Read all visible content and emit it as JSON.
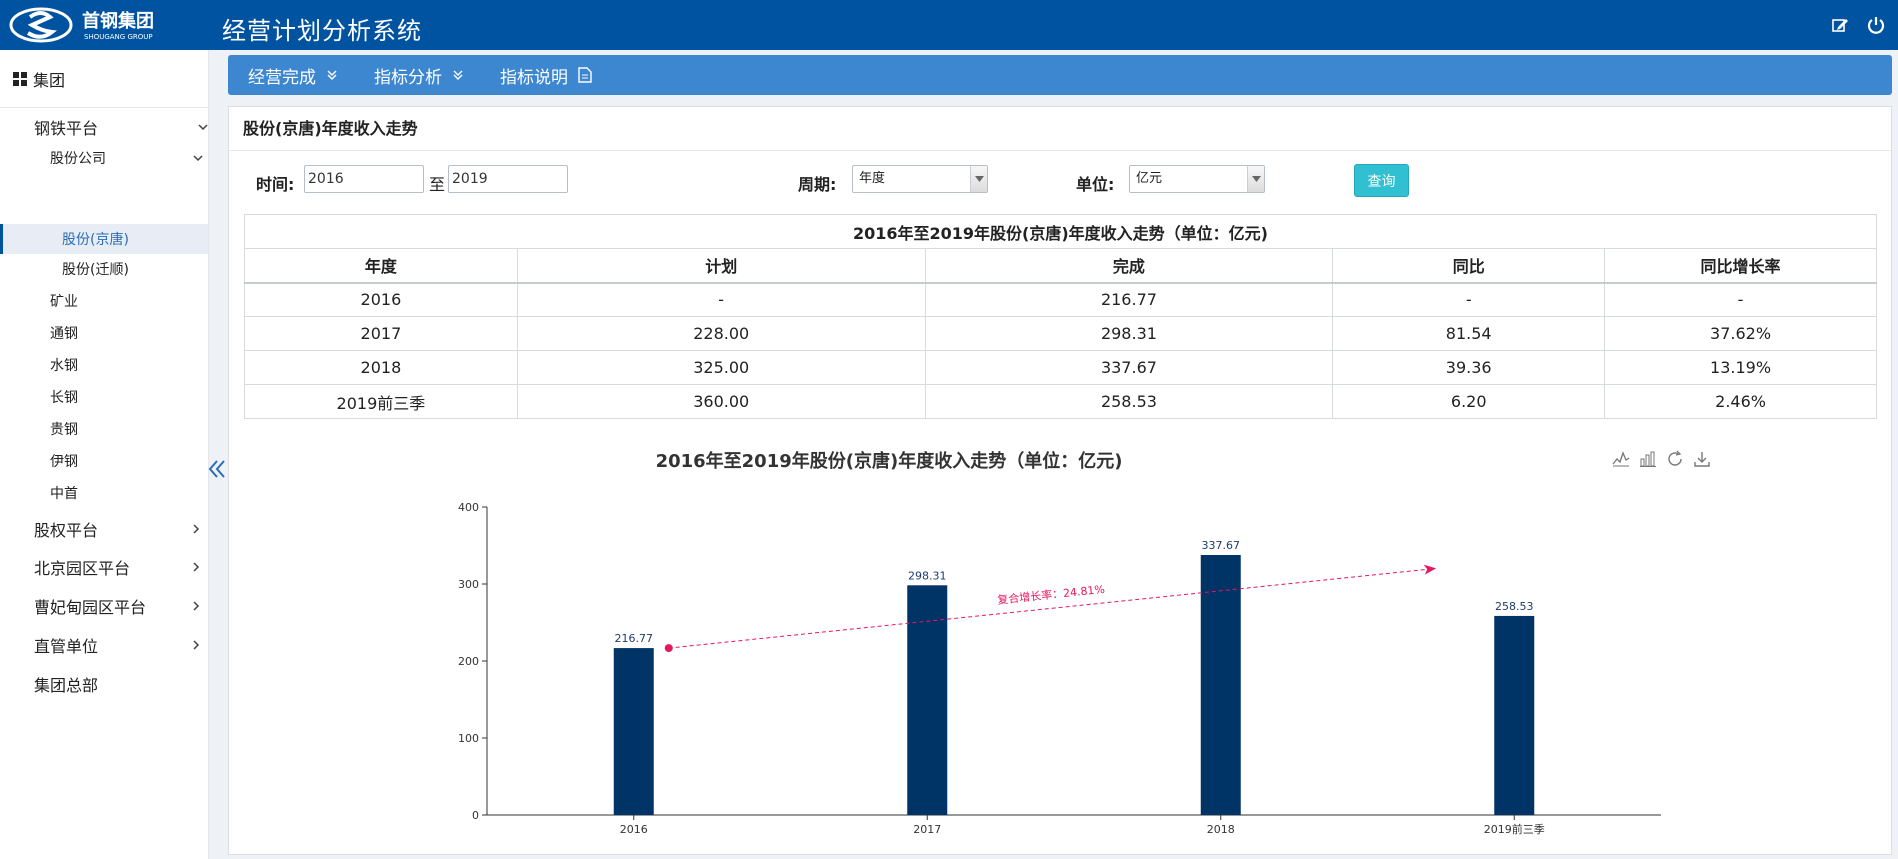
{
  "header": {
    "logo_text": "首钢集团",
    "logo_sub": "SHOUGANG GROUP",
    "system_title": "经营计划分析系统"
  },
  "sidebar": {
    "group_label": "集团",
    "items": [
      {
        "label": "钢铁平台",
        "level": 1,
        "expanded": true
      },
      {
        "label": "股份公司",
        "level": 2,
        "expanded": true
      },
      {
        "label": "股份(京唐)",
        "level": 3,
        "active": true
      },
      {
        "label": "股份(迁顺)",
        "level": 3
      },
      {
        "label": "矿业",
        "level": 2
      },
      {
        "label": "通钢",
        "level": 2
      },
      {
        "label": "水钢",
        "level": 2
      },
      {
        "label": "长钢",
        "level": 2
      },
      {
        "label": "贵钢",
        "level": 2
      },
      {
        "label": "伊钢",
        "level": 2
      },
      {
        "label": "中首",
        "level": 2
      },
      {
        "label": "股权平台",
        "level": 1
      },
      {
        "label": "北京园区平台",
        "level": 1
      },
      {
        "label": "曹妃甸园区平台",
        "level": 1
      },
      {
        "label": "直管单位",
        "level": 1
      },
      {
        "label": "集团总部",
        "level": 1
      }
    ]
  },
  "menu": {
    "items": [
      "经营完成",
      "指标分析",
      "指标说明"
    ]
  },
  "panel": {
    "title": "股份(京唐)年度收入走势"
  },
  "filters": {
    "time_label": "时间:",
    "start": "2016",
    "to_label": "至",
    "end": "2019",
    "period_label": "周期:",
    "period_value": "年度",
    "unit_label": "单位:",
    "unit_value": "亿元",
    "query_label": "查询"
  },
  "table": {
    "caption": "2016年至2019年股份(京唐)年度收入走势（单位：亿元)",
    "headers": [
      "年度",
      "计划",
      "完成",
      "同比",
      "同比增长率"
    ],
    "rows": [
      [
        "2016",
        "-",
        "216.77",
        "-",
        "-"
      ],
      [
        "2017",
        "228.00",
        "298.31",
        "81.54",
        "37.62%"
      ],
      [
        "2018",
        "325.00",
        "337.67",
        "39.36",
        "13.19%"
      ],
      [
        "2019前三季",
        "360.00",
        "258.53",
        "6.20",
        "2.46%"
      ]
    ]
  },
  "colors": {
    "header_bg": "#0053a0",
    "menu_bg": "#3d87d1",
    "bar": "#003366",
    "trend": "#e8175d",
    "query_btn": "#31c0d2"
  },
  "chart_data": {
    "type": "bar",
    "title": "2016年至2019年股份(京唐)年度收入走势（单位：亿元)",
    "categories": [
      "2016",
      "2017",
      "2018",
      "2019前三季"
    ],
    "values": [
      216.77,
      298.31,
      337.67,
      258.53
    ],
    "data_labels": [
      "216.77",
      "298.31",
      "337.67",
      "258.53"
    ],
    "ylim": [
      0,
      400
    ],
    "yticks": [
      0,
      100,
      200,
      300,
      400
    ],
    "ytick_labels": [
      "0",
      "100",
      "200",
      "300",
      "400"
    ],
    "xlabel": "",
    "ylabel": "",
    "grid": false,
    "annotation": {
      "text": "复合增长率：24.81%",
      "style": "dashed-arrow",
      "start": {
        "x": "2016",
        "y": 216.77
      },
      "end": {
        "x": "2019前三季",
        "y": 320
      }
    },
    "tools": [
      "line-chart-icon",
      "bar-chart-icon",
      "refresh-icon",
      "download-icon"
    ]
  }
}
